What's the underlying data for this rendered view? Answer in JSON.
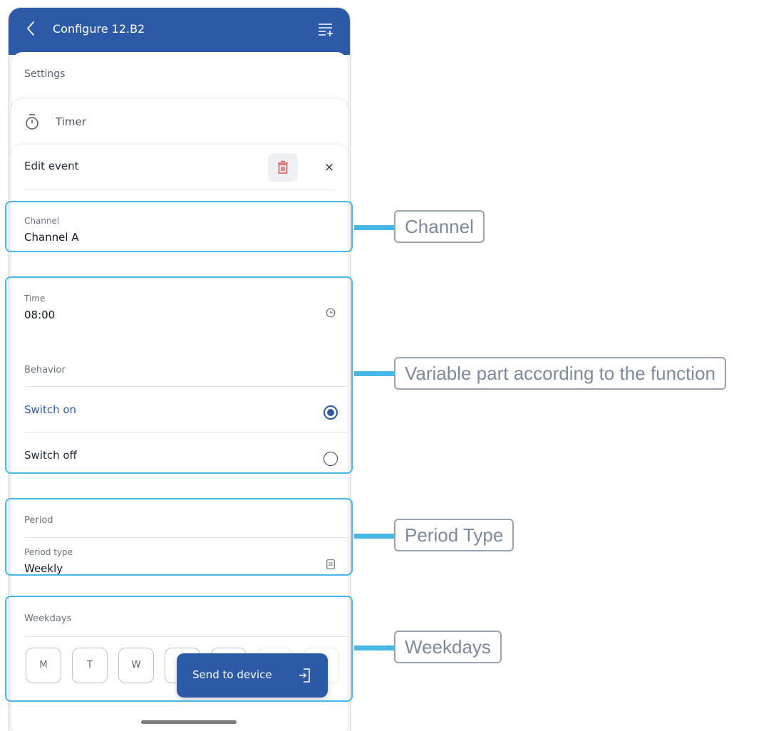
{
  "app": {
    "title": "Configure 12.B2",
    "accent": "#2d5aa6",
    "annotation_color": "#47b7e6"
  },
  "stack": {
    "settings_label": "Settings",
    "timer_label": "Timer"
  },
  "editor": {
    "title": "Edit event",
    "close_glyph": "×",
    "channel": {
      "label": "Channel",
      "value": "Channel A"
    },
    "time": {
      "label": "Time",
      "value": "08:00"
    },
    "behavior": {
      "section": "Behavior",
      "options": [
        {
          "label": "Switch on",
          "selected": true
        },
        {
          "label": "Switch off",
          "selected": false
        }
      ]
    },
    "period": {
      "section": "Period",
      "type_label": "Period type",
      "type_value": "Weekly"
    },
    "weekdays": {
      "section": "Weekdays",
      "days": [
        "M",
        "T",
        "W",
        "",
        "",
        "",
        ""
      ]
    },
    "send_label": "Send to device"
  },
  "annotations": [
    {
      "label": "Channel"
    },
    {
      "label": "Variable part according to the function"
    },
    {
      "label": "Period Type"
    },
    {
      "label": "Weekdays"
    }
  ]
}
